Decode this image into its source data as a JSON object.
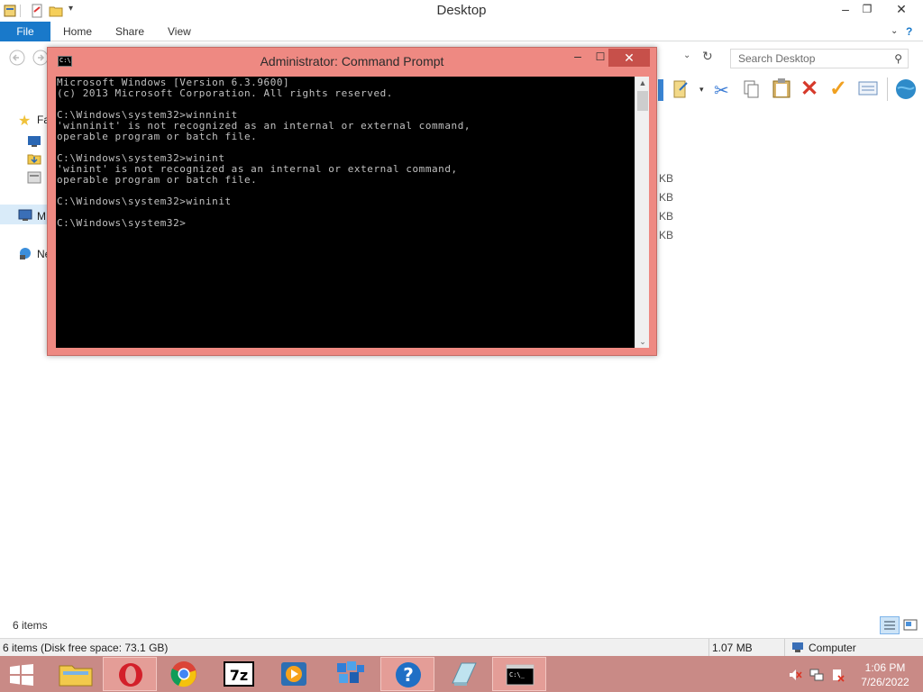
{
  "explorer": {
    "title": "Desktop",
    "ribbon_tabs": {
      "file": "File",
      "home": "Home",
      "share": "Share",
      "view": "View"
    },
    "search_placeholder": "Search Desktop",
    "nav_items": [
      "Fa",
      "M",
      "Ne"
    ],
    "file_sizes": [
      "KB",
      "KB",
      "KB",
      "KB"
    ],
    "item_count": "6 items",
    "details": {
      "summary": "6 items (Disk free space: 73.1 GB)",
      "size": "1.07 MB",
      "location": "Computer"
    }
  },
  "cmd": {
    "title": "Administrator: Command Prompt",
    "output": "Microsoft Windows [Version 6.3.9600]\n(c) 2013 Microsoft Corporation. All rights reserved.\n\nC:\\Windows\\system32>winninit\n'winninit' is not recognized as an internal or external command,\noperable program or batch file.\n\nC:\\Windows\\system32>winint\n'winint' is not recognized as an internal or external command,\noperable program or batch file.\n\nC:\\Windows\\system32>wininit\n\nC:\\Windows\\system32>"
  },
  "taskbar": {
    "apps": [
      "start-icon",
      "file-explorer-icon",
      "opera-icon",
      "chrome-icon",
      "7zip-icon",
      "media-player-icon",
      "app-tiles-icon",
      "help-icon",
      "notepad-icon",
      "command-prompt-icon"
    ],
    "clock": {
      "time": "1:06 PM",
      "date": "7/26/2022"
    },
    "colors": {
      "taskbar": "#c98a86",
      "active": "#e49d97"
    }
  },
  "colors": {
    "file_tab": "#1979ca",
    "cmd_frame": "#ee8982",
    "cmd_close": "#c7504a",
    "console_bg": "#000000",
    "console_text": "#c0c0c0"
  }
}
